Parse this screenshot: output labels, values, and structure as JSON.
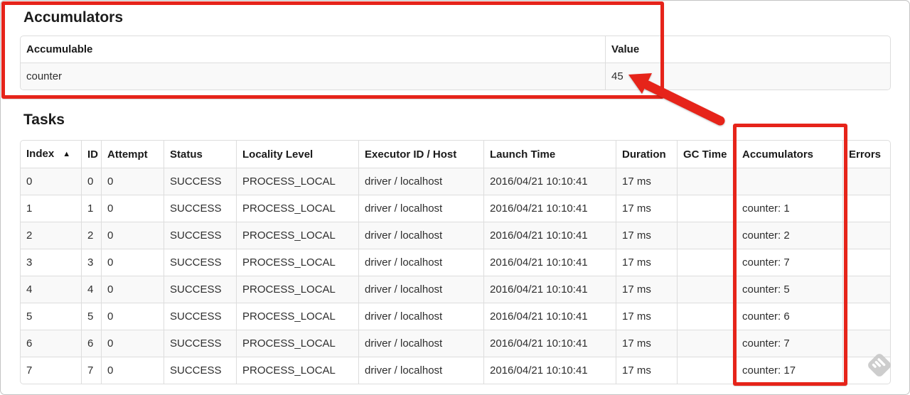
{
  "accumulators_section": {
    "title": "Accumulators",
    "table": {
      "headers": [
        "Accumulable",
        "Value"
      ],
      "rows": [
        [
          "counter",
          "45"
        ]
      ]
    }
  },
  "tasks_section": {
    "title": "Tasks",
    "table": {
      "headers": [
        "Index",
        "ID",
        "Attempt",
        "Status",
        "Locality Level",
        "Executor ID / Host",
        "Launch Time",
        "Duration",
        "GC Time",
        "Accumulators",
        "Errors"
      ],
      "sort": {
        "column": "Index",
        "direction": "ascending",
        "icon": "▲"
      },
      "rows": [
        [
          "0",
          "0",
          "0",
          "SUCCESS",
          "PROCESS_LOCAL",
          "driver / localhost",
          "2016/04/21 10:10:41",
          "17 ms",
          "",
          "",
          ""
        ],
        [
          "1",
          "1",
          "0",
          "SUCCESS",
          "PROCESS_LOCAL",
          "driver / localhost",
          "2016/04/21 10:10:41",
          "17 ms",
          "",
          "counter: 1",
          ""
        ],
        [
          "2",
          "2",
          "0",
          "SUCCESS",
          "PROCESS_LOCAL",
          "driver / localhost",
          "2016/04/21 10:10:41",
          "17 ms",
          "",
          "counter: 2",
          ""
        ],
        [
          "3",
          "3",
          "0",
          "SUCCESS",
          "PROCESS_LOCAL",
          "driver / localhost",
          "2016/04/21 10:10:41",
          "17 ms",
          "",
          "counter: 7",
          ""
        ],
        [
          "4",
          "4",
          "0",
          "SUCCESS",
          "PROCESS_LOCAL",
          "driver / localhost",
          "2016/04/21 10:10:41",
          "17 ms",
          "",
          "counter: 5",
          ""
        ],
        [
          "5",
          "5",
          "0",
          "SUCCESS",
          "PROCESS_LOCAL",
          "driver / localhost",
          "2016/04/21 10:10:41",
          "17 ms",
          "",
          "counter: 6",
          ""
        ],
        [
          "6",
          "6",
          "0",
          "SUCCESS",
          "PROCESS_LOCAL",
          "driver / localhost",
          "2016/04/21 10:10:41",
          "17 ms",
          "",
          "counter: 7",
          ""
        ],
        [
          "7",
          "7",
          "0",
          "SUCCESS",
          "PROCESS_LOCAL",
          "driver / localhost",
          "2016/04/21 10:10:41",
          "17 ms",
          "",
          "counter: 17",
          ""
        ]
      ]
    }
  },
  "annotations": {
    "accent_color": "#e6241a",
    "watermark_icon": "feedly-logo"
  },
  "colors": {
    "table_border": "#dddddd",
    "row_stripe": "#f9f9f9",
    "heading_text": "#1c1c1c",
    "body_text": "#2e2e2e"
  }
}
